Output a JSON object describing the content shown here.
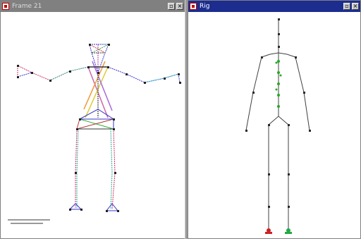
{
  "left_window": {
    "title": "Frame 21",
    "controls": {
      "restore": "▫",
      "close": "×"
    }
  },
  "right_window": {
    "title": "Rig",
    "controls": {
      "restore": "▫",
      "close": "×"
    }
  },
  "colors": {
    "active_title": "#1c2d8f",
    "inactive_title": "#808080",
    "bone": "#404040",
    "joint": "#2a2a2a",
    "spine_marker": "#22aa22",
    "left_foot": "#cc2222",
    "right_foot": "#22aa44"
  }
}
